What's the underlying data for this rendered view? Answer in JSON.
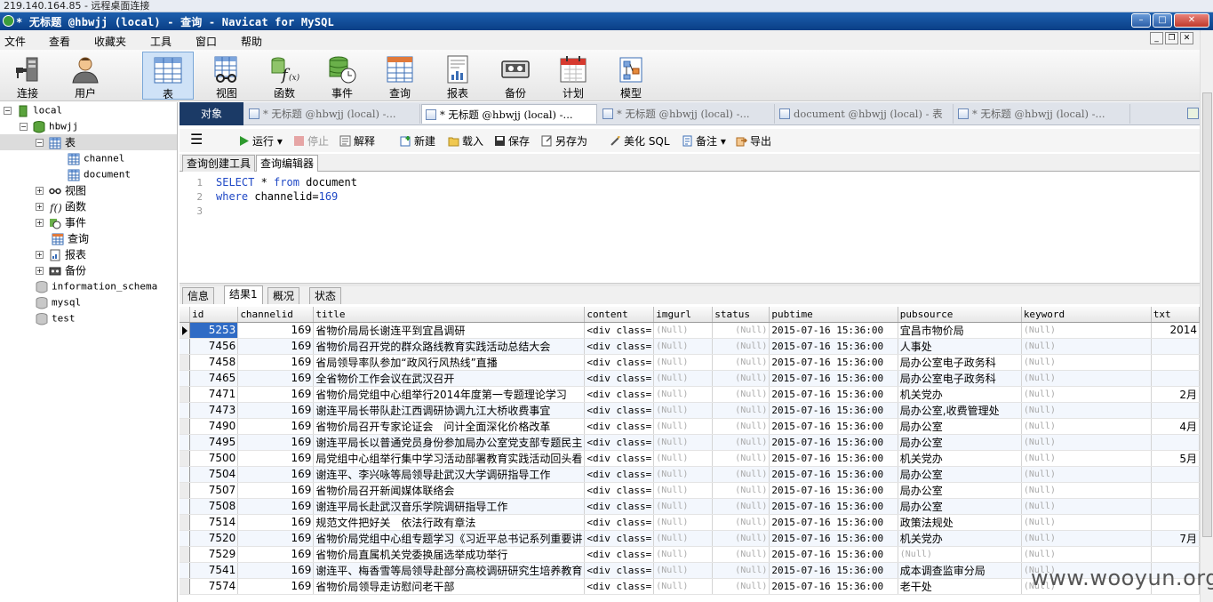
{
  "remote_bar": {
    "text": "219.140.164.85 - 远程桌面连接"
  },
  "window": {
    "title": "* 无标题 @hbwjj (local) - 查询 - Navicat for MySQL"
  },
  "menu": [
    "文件",
    "查看",
    "收藏夹",
    "工具",
    "窗口",
    "帮助"
  ],
  "toolbar": [
    {
      "label": "连接",
      "icon": "plug-icon"
    },
    {
      "label": "用户",
      "icon": "user-icon"
    },
    {
      "label": "表",
      "icon": "table-icon"
    },
    {
      "label": "视图",
      "icon": "view-icon"
    },
    {
      "label": "函数",
      "icon": "function-icon"
    },
    {
      "label": "事件",
      "icon": "event-icon"
    },
    {
      "label": "查询",
      "icon": "query-icon"
    },
    {
      "label": "报表",
      "icon": "report-icon"
    },
    {
      "label": "备份",
      "icon": "backup-icon"
    },
    {
      "label": "计划",
      "icon": "calendar-icon"
    },
    {
      "label": "模型",
      "icon": "model-icon"
    }
  ],
  "tree": {
    "connection": "local",
    "database": "hbwjj",
    "tables_label": "表",
    "tables": [
      "channel",
      "document"
    ],
    "views_label": "视图",
    "functions_label": "函数",
    "events_label": "事件",
    "queries_label": "查询",
    "reports_label": "报表",
    "backups_label": "备份",
    "other_dbs": [
      "information_schema",
      "mysql",
      "test"
    ]
  },
  "doc_tabs": {
    "object": "对象",
    "tabs": [
      "* 无标题 @hbwjj (local) -...",
      "* 无标题 @hbwjj (local) -...",
      "* 无标题 @hbwjj (local) -...",
      "document @hbwjj (local) - 表",
      "* 无标题 @hbwjj (local) -..."
    ]
  },
  "query_toolbar": {
    "run": "运行",
    "stop": "停止",
    "explain": "解释",
    "new": "新建",
    "load": "载入",
    "save": "保存",
    "save_as": "另存为",
    "beautify": "美化 SQL",
    "note": "备注",
    "export": "导出"
  },
  "editor_tabs": [
    "查询创建工具",
    "查询编辑器"
  ],
  "sql": {
    "line1": {
      "num": "1",
      "kw1": "SELECT",
      "mid": " * ",
      "kw2": "from",
      "rest": " document"
    },
    "line2": {
      "num": "2",
      "kw": "where",
      "rest": " channelid=",
      "value": "169"
    },
    "line3": {
      "num": "3"
    }
  },
  "result_tabs": [
    "信息",
    "结果1",
    "概况",
    "状态"
  ],
  "columns": [
    "id",
    "channelid",
    "title",
    "content",
    "imgurl",
    "status",
    "pubtime",
    "pubsource",
    "keyword",
    "txt"
  ],
  "rows": [
    {
      "id": "5253",
      "channelid": "169",
      "title": "省物价局局长谢连平到宜昌调研",
      "content": "<div class=",
      "pubtime": "2015-07-16 15:36:00",
      "pubsource": "宜昌市物价局",
      "txt": "2014"
    },
    {
      "id": "7456",
      "channelid": "169",
      "title": "省物价局召开党的群众路线教育实践活动总结大会",
      "content": "<div class=",
      "pubtime": "2015-07-16 15:36:00",
      "pubsource": "人事处",
      "txt": ""
    },
    {
      "id": "7458",
      "channelid": "169",
      "title": "省局领导率队参加“政风行风热线”直播",
      "content": "<div class=",
      "pubtime": "2015-07-16 15:36:00",
      "pubsource": "局办公室电子政务科",
      "txt": ""
    },
    {
      "id": "7465",
      "channelid": "169",
      "title": "全省物价工作会议在武汉召开",
      "content": "<div class=",
      "pubtime": "2015-07-16 15:36:00",
      "pubsource": "局办公室电子政务科",
      "txt": ""
    },
    {
      "id": "7471",
      "channelid": "169",
      "title": "省物价局党组中心组举行2014年度第一专题理论学习",
      "content": "<div class=",
      "pubtime": "2015-07-16 15:36:00",
      "pubsource": "机关党办",
      "txt": "2月"
    },
    {
      "id": "7473",
      "channelid": "169",
      "title": "谢连平局长带队赴江西调研协调九江大桥收费事宜",
      "content": "<div class=",
      "pubtime": "2015-07-16 15:36:00",
      "pubsource": "局办公室,收费管理处",
      "txt": ""
    },
    {
      "id": "7490",
      "channelid": "169",
      "title": "省物价局召开专家论证会　问计全面深化价格改革",
      "content": "<div class=",
      "pubtime": "2015-07-16 15:36:00",
      "pubsource": "局办公室",
      "txt": "4月"
    },
    {
      "id": "7495",
      "channelid": "169",
      "title": "谢连平局长以普通党员身份参加局办公室党支部专题民主",
      "content": "<div class=",
      "pubtime": "2015-07-16 15:36:00",
      "pubsource": "局办公室",
      "txt": ""
    },
    {
      "id": "7500",
      "channelid": "169",
      "title": "局党组中心组举行集中学习活动部署教育实践活动回头看",
      "content": "<div class=",
      "pubtime": "2015-07-16 15:36:00",
      "pubsource": "机关党办",
      "txt": "5月"
    },
    {
      "id": "7504",
      "channelid": "169",
      "title": "谢连平、李兴咏等局领导赴武汉大学调研指导工作",
      "content": "<div class=",
      "pubtime": "2015-07-16 15:36:00",
      "pubsource": "局办公室",
      "txt": ""
    },
    {
      "id": "7507",
      "channelid": "169",
      "title": "省物价局召开新闻媒体联络会",
      "content": "<div class=",
      "pubtime": "2015-07-16 15:36:00",
      "pubsource": "局办公室",
      "txt": ""
    },
    {
      "id": "7508",
      "channelid": "169",
      "title": "谢连平局长赴武汉音乐学院调研指导工作",
      "content": "<div class=",
      "pubtime": "2015-07-16 15:36:00",
      "pubsource": "局办公室",
      "txt": ""
    },
    {
      "id": "7514",
      "channelid": "169",
      "title": "规范文件把好关　依法行政有章法",
      "content": "<div class=",
      "pubtime": "2015-07-16 15:36:00",
      "pubsource": "政策法规处",
      "txt": ""
    },
    {
      "id": "7520",
      "channelid": "169",
      "title": "省物价局党组中心组专题学习《习近平总书记系列重要讲",
      "content": "<div class=",
      "pubtime": "2015-07-16 15:36:00",
      "pubsource": "机关党办",
      "txt": "7月"
    },
    {
      "id": "7529",
      "channelid": "169",
      "title": "省物价局直属机关党委换届选举成功举行",
      "content": "<div class=",
      "pubtime": "2015-07-16 15:36:00",
      "pubsource": "(Null)",
      "txt": ""
    },
    {
      "id": "7541",
      "channelid": "169",
      "title": "谢连平、梅香雪等局领导赴部分高校调研研究生培养教育",
      "content": "<div class=",
      "pubtime": "2015-07-16 15:36:00",
      "pubsource": "成本调查监审分局",
      "txt": ""
    },
    {
      "id": "7574",
      "channelid": "169",
      "title": "省物价局领导走访慰问老干部",
      "content": "<div class=",
      "pubtime": "2015-07-16 15:36:00",
      "pubsource": "老干处",
      "txt": ""
    }
  ],
  "null_text": "(Null)",
  "watermark": "www.wooyun.org",
  "colors": {
    "titlebar": "#0a3f86",
    "selection": "#2f6bc5",
    "keyword": "#1f48c5",
    "object_tab": "#1b3a66"
  }
}
